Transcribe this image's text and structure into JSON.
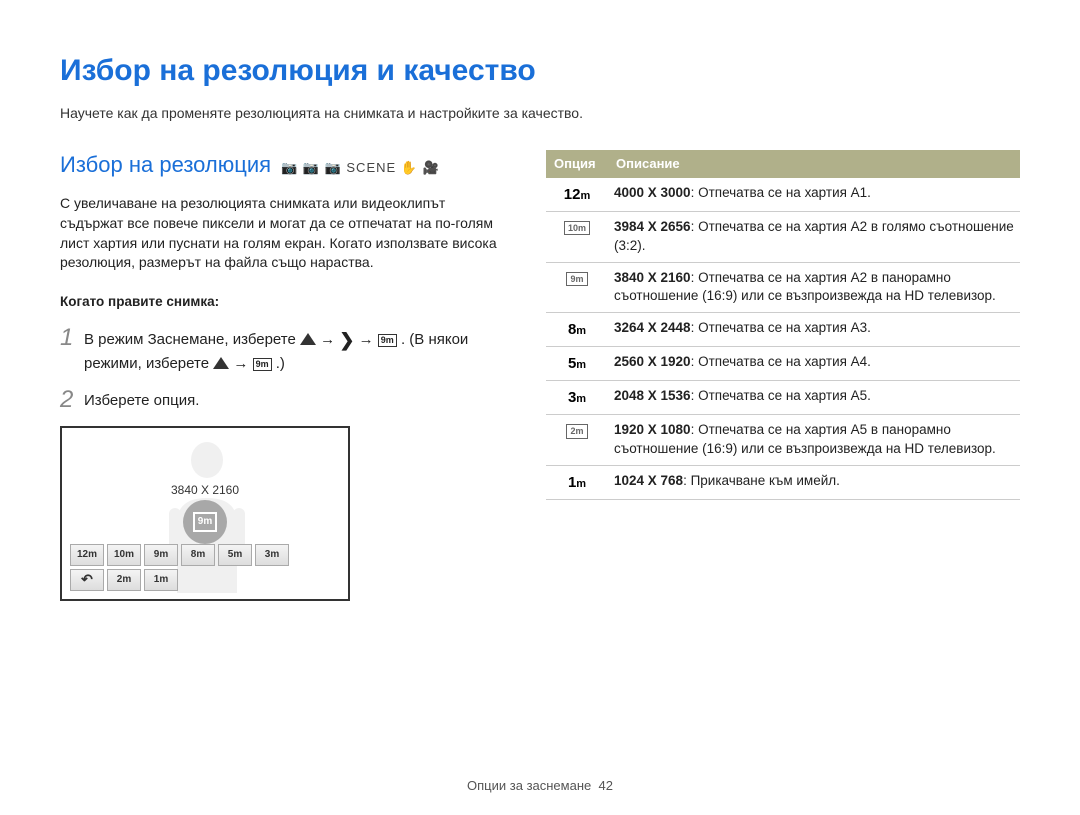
{
  "page": {
    "main_title": "Избор на резолюция и качество",
    "subtitle": "Научете как да променяте резолюцията на снимката и настройките за качество.",
    "footer_label": "Опции за заснемане",
    "footer_page": "42"
  },
  "section": {
    "title": "Избор на резолюция",
    "mode_text": "SCENE",
    "intro": "С увеличаване на резолюцията снимката или видеоклипът съдържат все повече пиксели и могат да се отпечатат на по-голям лист хартия или пуснати на голям екран. Когато използвате висока резолюция, размерът на файла също нараства.",
    "subhead": "Когато правите снимка:"
  },
  "steps": {
    "s1_a": "В режим Заснемане, изберете ",
    "s1_b": ". (В някои режими, изберете ",
    "s1_c": ".)",
    "s2": "Изберете опция."
  },
  "preview": {
    "label": "3840 X 2160",
    "center_icon": "9m",
    "row1": [
      "12m",
      "10m",
      "9m",
      "8m",
      "5m",
      "3m"
    ],
    "row2_back": "↶",
    "row2": [
      "2m",
      "1m"
    ]
  },
  "table": {
    "h1": "Опция",
    "h2": "Описание",
    "rows": [
      {
        "icon_type": "solid",
        "icon": "12m",
        "bold": "4000 X 3000",
        "text": ": Отпечатва се на хартия A1."
      },
      {
        "icon_type": "box",
        "icon": "10m",
        "bold": "3984 X 2656",
        "text": ": Отпечатва се на хартия A2 в голямо съотношение (3:2)."
      },
      {
        "icon_type": "box",
        "icon": "9m",
        "bold": "3840 X 2160",
        "text": ": Отпечатва се на хартия A2 в панорамно съотношение (16:9) или се възпроизвежда на HD телевизор."
      },
      {
        "icon_type": "solid",
        "icon": "8m",
        "bold": "3264 X 2448",
        "text": ": Отпечатва се на хартия A3."
      },
      {
        "icon_type": "solid",
        "icon": "5m",
        "bold": "2560 X 1920",
        "text": ": Отпечатва се на хартия A4."
      },
      {
        "icon_type": "solid",
        "icon": "3m",
        "bold": "2048 X 1536",
        "text": ": Отпечатва се на хартия A5."
      },
      {
        "icon_type": "box",
        "icon": "2m",
        "bold": "1920 X 1080",
        "text": ": Отпечатва се на хартия A5 в панорамно съотношение (16:9) или се възпроизвежда на HD телевизор."
      },
      {
        "icon_type": "solid",
        "icon": "1m",
        "bold": "1024 X 768",
        "text": ": Прикачване към имейл."
      }
    ]
  }
}
